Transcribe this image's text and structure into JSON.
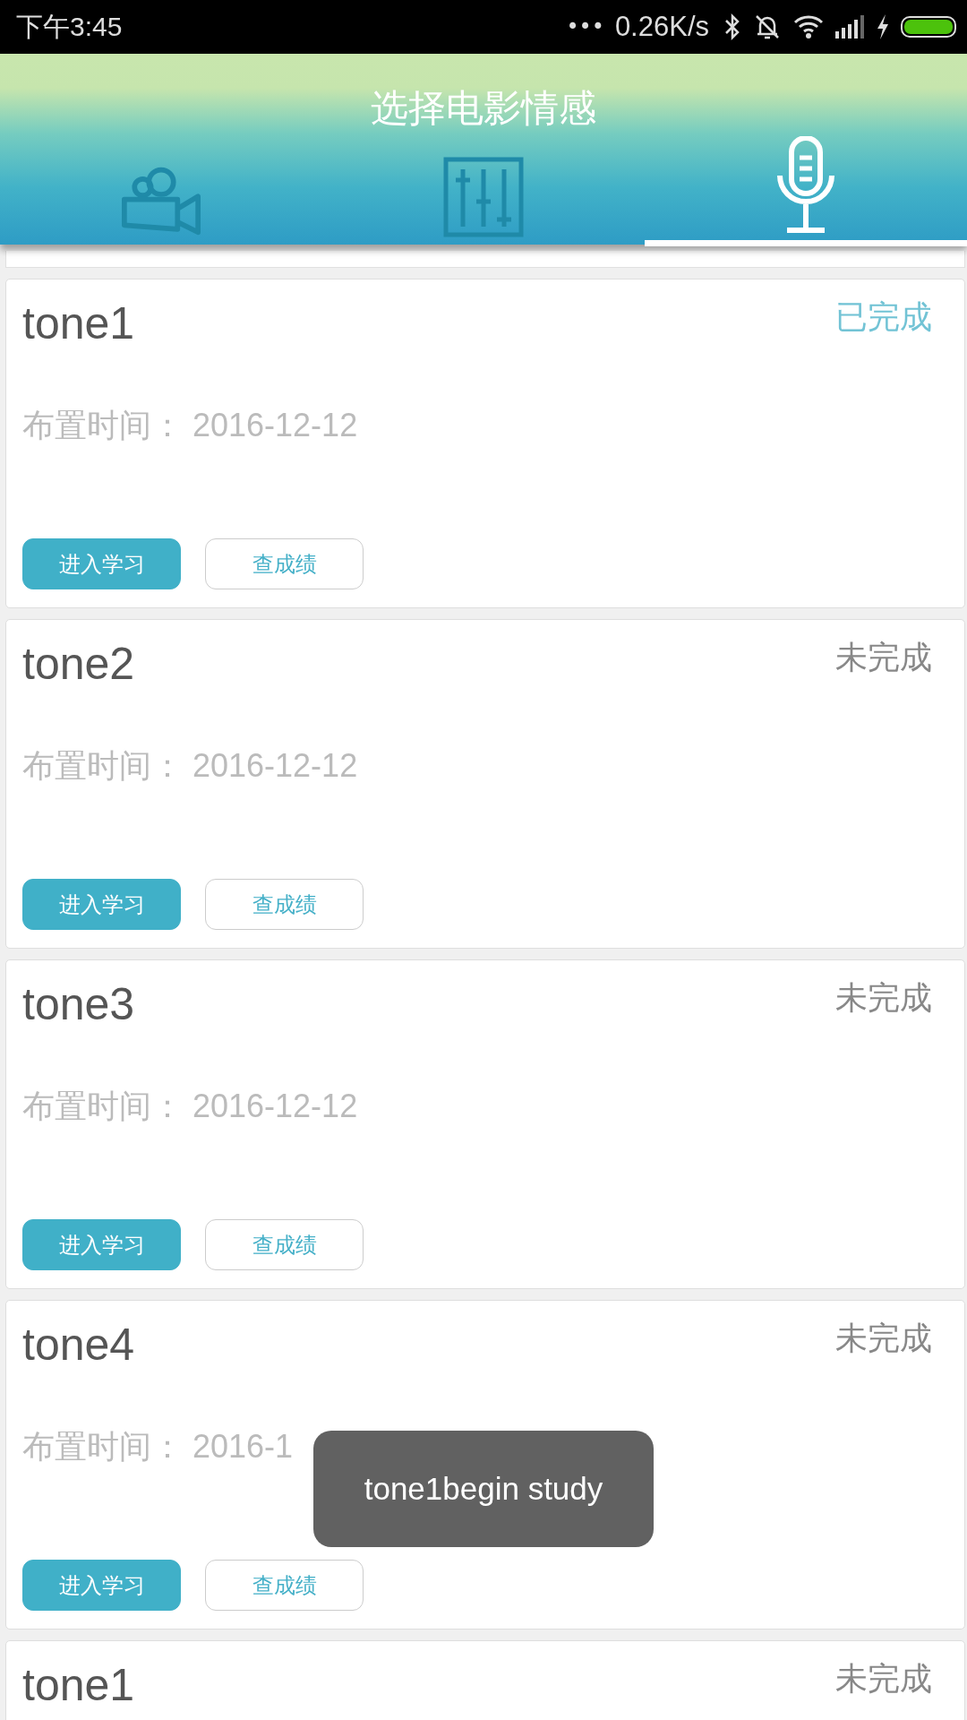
{
  "status_bar": {
    "time": "下午3:45",
    "dots": "•••",
    "speed": "0.26K/s"
  },
  "header": {
    "title": "选择电影情感"
  },
  "tabs": [
    {
      "kind": "camera",
      "selected": false
    },
    {
      "kind": "mixer",
      "selected": false
    },
    {
      "kind": "microphone",
      "selected": true
    }
  ],
  "cards": [
    {
      "title": "tone1",
      "completed": true,
      "status": "已完成",
      "date_label": "布置时间：",
      "date": "2016-12-12",
      "buttons": [
        "进入学习",
        "查成绩"
      ]
    },
    {
      "title": "tone2",
      "completed": false,
      "status": "未完成",
      "date_label": "布置时间：",
      "date": "2016-12-12",
      "buttons": [
        "进入学习",
        "查成绩"
      ]
    },
    {
      "title": "tone3",
      "completed": false,
      "status": "未完成",
      "date_label": "布置时间：",
      "date": "2016-12-12",
      "buttons": [
        "进入学习",
        "查成绩"
      ]
    },
    {
      "title": "tone4",
      "completed": false,
      "status": "未完成",
      "date_label": "布置时间：",
      "date": "2016-1",
      "buttons": [
        "进入学习",
        "查成绩"
      ]
    },
    {
      "title": "tone1",
      "completed": false,
      "status": "未完成"
    }
  ],
  "toast": {
    "text": "tone1begin study"
  }
}
